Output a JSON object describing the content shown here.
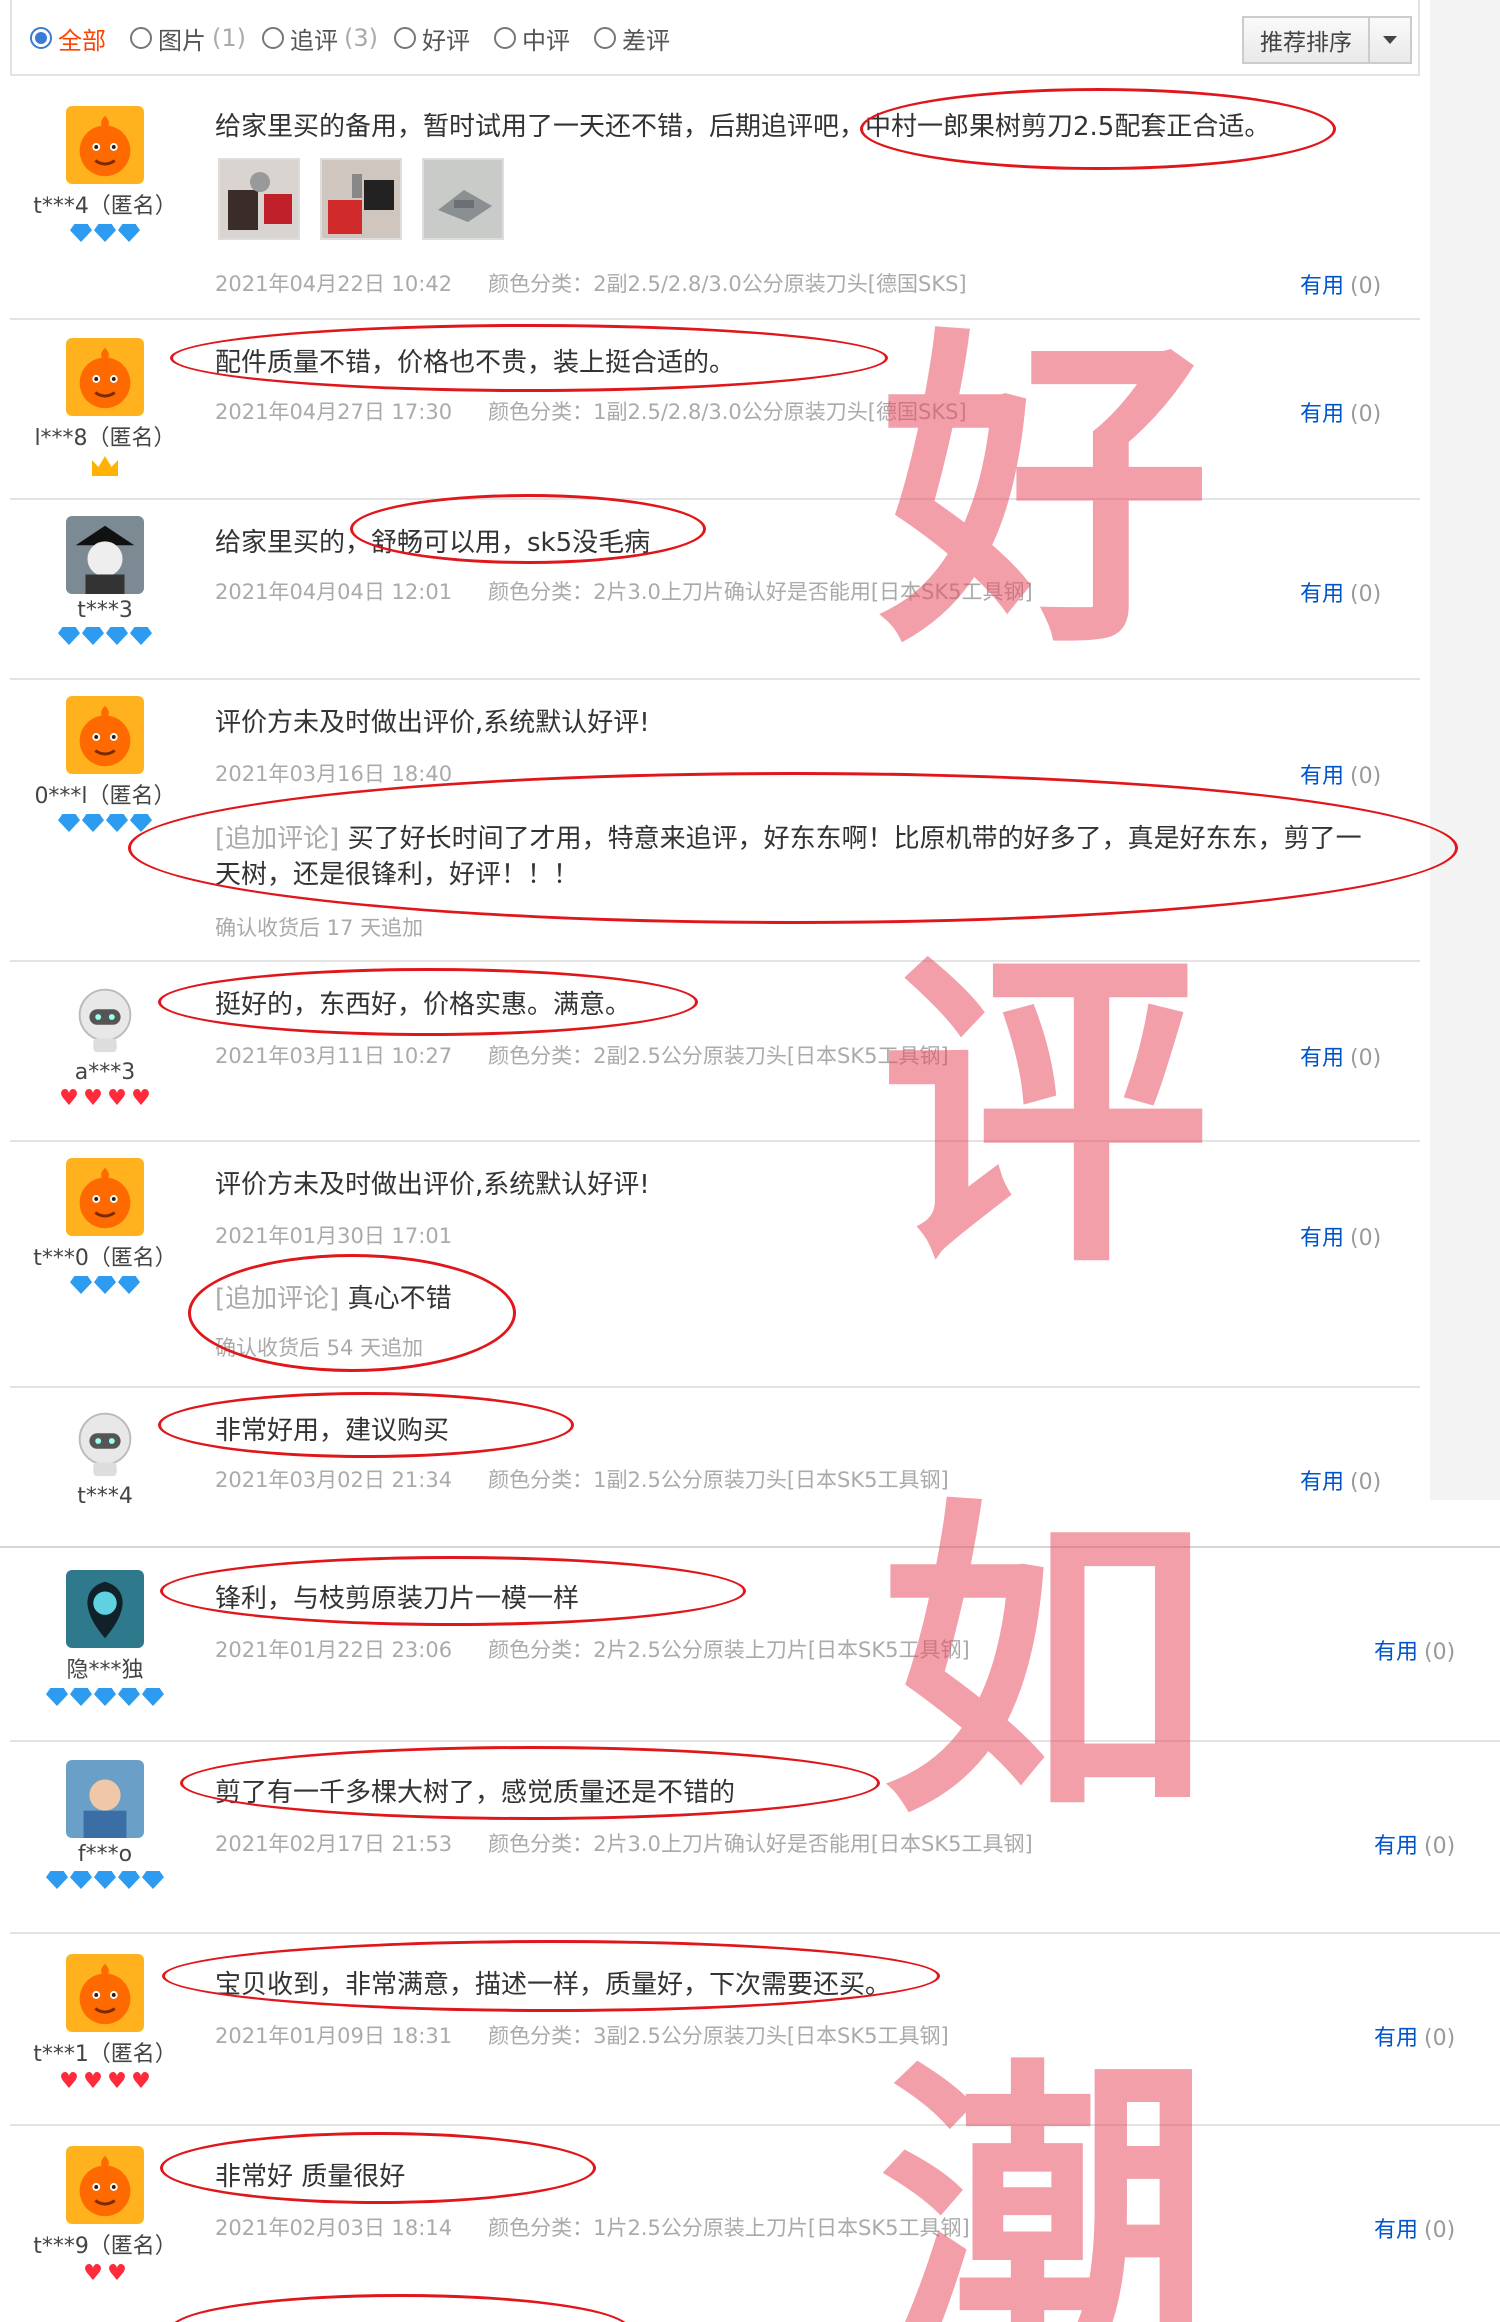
{
  "filters": [
    {
      "label": "全部",
      "count": "",
      "selected": true
    },
    {
      "label": "图片",
      "count": "(1)",
      "selected": false
    },
    {
      "label": "追评",
      "count": "(3)",
      "selected": false
    },
    {
      "label": "好评",
      "count": "",
      "selected": false
    },
    {
      "label": "中评",
      "count": "",
      "selected": false
    },
    {
      "label": "差评",
      "count": "",
      "selected": false
    }
  ],
  "sort": {
    "label": "推荐排序"
  },
  "watermark": {
    "chars": [
      "好",
      "评",
      "如",
      "潮"
    ]
  },
  "reviews": [
    {
      "user": "t***4（匿名）",
      "text": "给家里买的备用，暂时试用了一天还不错，后期追评吧，中村一郎果树剪刀2.5配套正合适。",
      "date": "2021年04月22日 10:42",
      "sku": "颜色分类：2副2.5/2.8/3.0公分原装刀头[德国SKS]",
      "useful": "有用",
      "count": "(0)"
    },
    {
      "user": "l***8（匿名）",
      "text": "配件质量不错，价格也不贵，装上挺合适的。",
      "date": "2021年04月27日 17:30",
      "sku": "颜色分类：1副2.5/2.8/3.0公分原装刀头[德国SKS]",
      "useful": "有用",
      "count": "(0)"
    },
    {
      "user": "t***3",
      "text": "给家里买的，舒畅可以用，sk5没毛病",
      "date": "2021年04月04日 12:01",
      "sku": "颜色分类：2片3.0上刀片确认好是否能用[日本SK5工具钢]",
      "useful": "有用",
      "count": "(0)"
    },
    {
      "user": "0***l（匿名）",
      "text": "评价方未及时做出评价,系统默认好评!",
      "date": "2021年03月16日 18:40",
      "sku": "",
      "useful": "有用",
      "count": "(0)",
      "append_tag": "[追加评论]",
      "append_line1": "买了好长时间了才用，特意来追评，好东东啊！比原机带的好多了，真是好东东，剪了一",
      "append_line2": "天树，还是很锋利，好评！！！",
      "append_note": "确认收货后 17 天追加"
    },
    {
      "user": "a***3",
      "text": "挺好的，东西好，价格实惠。满意。",
      "date": "2021年03月11日 10:27",
      "sku": "颜色分类：2副2.5公分原装刀头[日本SK5工具钢]",
      "useful": "有用",
      "count": "(0)"
    },
    {
      "user": "t***0（匿名）",
      "text": "评价方未及时做出评价,系统默认好评!",
      "date": "2021年01月30日 17:01",
      "sku": "",
      "useful": "有用",
      "count": "(0)",
      "append_tag": "[追加评论]",
      "append_line1": "真心不错",
      "append_note": "确认收货后 54 天追加"
    },
    {
      "user": "t***4",
      "text": "非常好用，建议购买",
      "date": "2021年03月02日 21:34",
      "sku": "颜色分类：1副2.5公分原装刀头[日本SK5工具钢]",
      "useful": "有用",
      "count": "(0)"
    },
    {
      "user": "隐***独",
      "text": "锋利，与枝剪原装刀片一模一样",
      "date": "2021年01月22日 23:06",
      "sku": "颜色分类：2片2.5公分原装上刀片[日本SK5工具钢]",
      "useful": "有用",
      "count": "(0)"
    },
    {
      "user": "f***o",
      "text": "剪了有一千多棵大树了，感觉质量还是不错的",
      "date": "2021年02月17日 21:53",
      "sku": "颜色分类：2片3.0上刀片确认好是否能用[日本SK5工具钢]",
      "useful": "有用",
      "count": "(0)"
    },
    {
      "user": "t***1（匿名）",
      "text": "宝贝收到，非常满意，描述一样，质量好，下次需要还买。",
      "date": "2021年01月09日 18:31",
      "sku": "颜色分类：3副2.5公分原装刀头[日本SK5工具钢]",
      "useful": "有用",
      "count": "(0)"
    },
    {
      "user": "t***9（匿名）",
      "text": "非常好 质量很好",
      "date": "2021年02月03日 18:14",
      "sku": "颜色分类：1片2.5公分原装上刀片[日本SK5工具钢]",
      "useful": "有用",
      "count": "(0)"
    }
  ]
}
